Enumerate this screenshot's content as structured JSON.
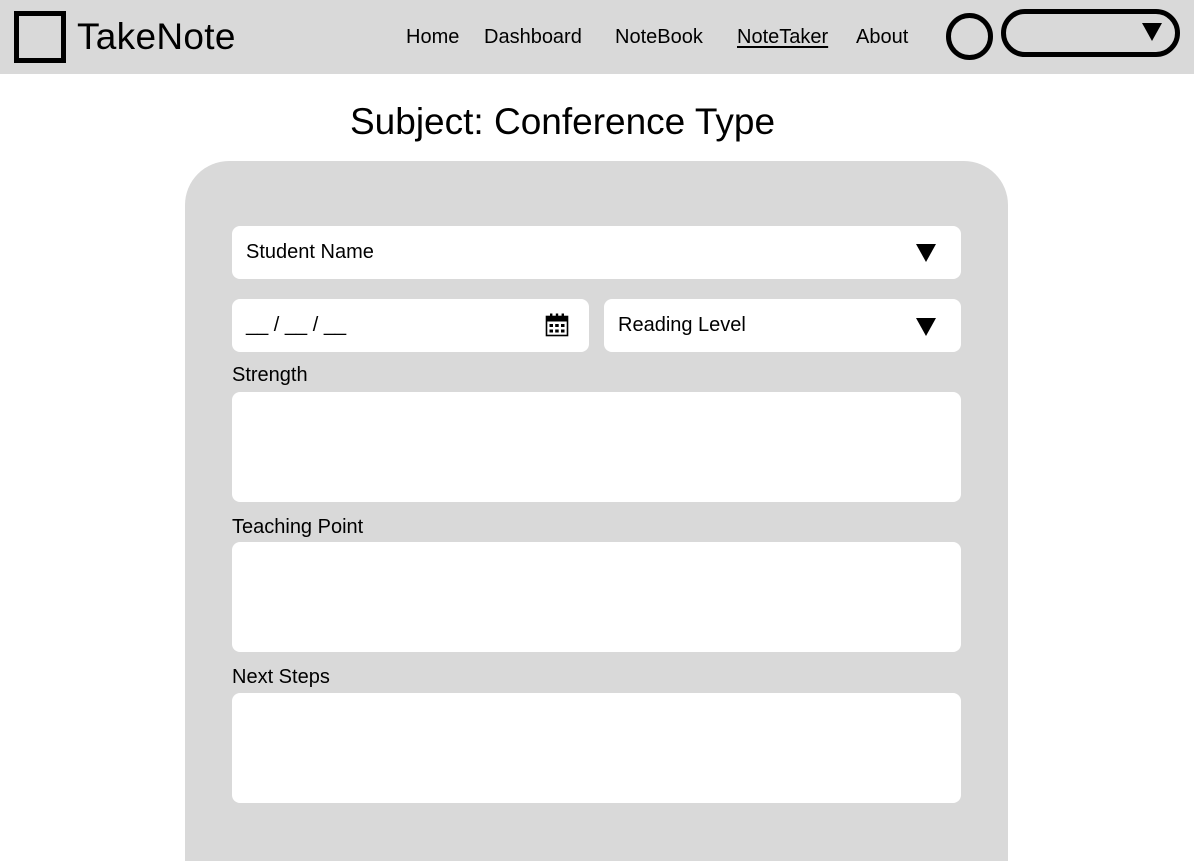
{
  "header": {
    "brand": "TakeNote",
    "nav": [
      {
        "label": "Home"
      },
      {
        "label": "Dashboard"
      },
      {
        "label": "NoteBook"
      },
      {
        "label": "NoteTaker",
        "active": true
      },
      {
        "label": "About"
      }
    ],
    "account_select_value": ""
  },
  "page": {
    "title": "Subject: Conference Type"
  },
  "form": {
    "student_name_placeholder": "Student Name",
    "date_placeholder": "__ / __ / __",
    "reading_level_placeholder": "Reading Level",
    "strength_label": "Strength",
    "teaching_point_label": "Teaching Point",
    "next_steps_label": "Next Steps"
  },
  "colors": {
    "header_bg": "#d9d9d9",
    "panel_bg": "#d9d9d9",
    "field_bg": "#ffffff",
    "ink": "#000000"
  },
  "icons": {
    "logo": "square-logo-icon",
    "avatar": "user-circle-icon",
    "dropdown": "chevron-down-icon",
    "calendar": "calendar-icon"
  }
}
